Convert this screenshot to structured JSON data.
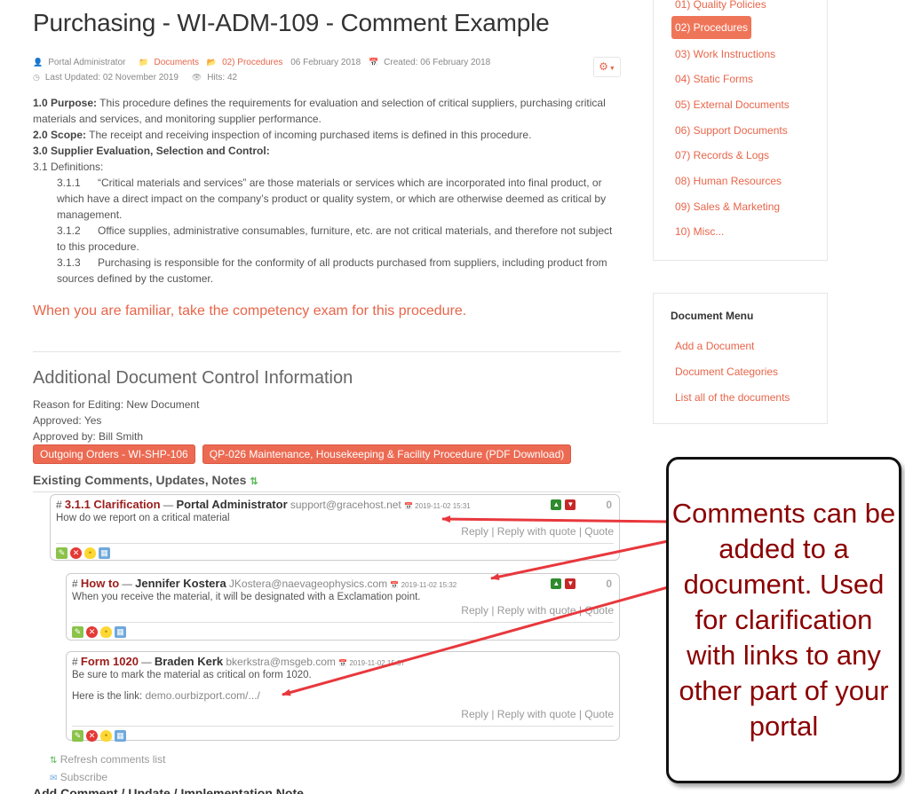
{
  "page": {
    "title": "Purchasing - WI-ADM-109 - Comment Example"
  },
  "meta": {
    "author": "Portal Administrator",
    "category_link": "Documents",
    "subcategory_link": "02) Procedures",
    "date": "06 February 2018",
    "created": "Created: 06 February 2018",
    "last_updated": "Last Updated: 02 November 2019",
    "hits": "Hits: 42"
  },
  "body": {
    "p1_label": "1.0  Purpose:",
    "p1_text": "  This procedure defines the requirements for evaluation and selection of critical suppliers, purchasing critical materials and services, and monitoring supplier performance.",
    "p2_label": "2.0  Scope:",
    "p2_text": " The receipt and receiving inspection of incoming purchased items is defined in this procedure.",
    "p3_label": "3.0  Supplier Evaluation, Selection and Control:",
    "p31": "3.1  Definitions:",
    "d1_num": "3.1.1",
    "d1_text": "“Critical materials and services” are those materials or services which are incorporated into final product, or which have a direct impact on the company’s product or quality system, or which are otherwise deemed as critical by management.",
    "d2_num": "3.1.2",
    "d2_text": "Office supplies, administrative consumables, furniture, etc. are not critical materials, and therefore not subject to this procedure.",
    "d3_num": "3.1.3",
    "d3_text": "Purchasing is responsible for the conformity of all products purchased from suppliers, including product from sources defined by the customer.",
    "exam_link": "When you are familiar, take the competency exam for this procedure."
  },
  "control": {
    "heading": "Additional Document Control Information",
    "reason": "Reason for Editing: New Document",
    "approved": "Approved: Yes",
    "approved_by": "Approved by: Bill Smith",
    "related": [
      "Outgoing Orders - WI-SHP-106",
      "QP-026 Maintenance, Housekeeping & Facility Procedure (PDF Download)"
    ]
  },
  "comments": {
    "heading": "Existing Comments, Updates, Notes",
    "items": [
      {
        "hash": "#",
        "title": "3.1.1 Clarification",
        "sep": " — ",
        "author": "Portal Administrator",
        "email": "support@gracehost.net",
        "date": "2019-11-02 15:31",
        "text": "How do we report on a critical material",
        "text2": "",
        "link": "",
        "score": "0"
      },
      {
        "hash": "#",
        "title": "How to",
        "sep": " — ",
        "author": "Jennifer Kostera",
        "email": "JKostera@naevageophysics.com",
        "date": "2019-11-02 15:32",
        "text": "When you receive the material, it will be designated with a Exclamation point.",
        "text2": "",
        "link": "",
        "score": "0"
      },
      {
        "hash": "#",
        "title": "Form 1020",
        "sep": " — ",
        "author": "Braden Kerk",
        "email": "bkerkstra@msgeb.com",
        "date": "2019-11-02 15:37",
        "text": "Be sure to mark the material as critical on form 1020.",
        "text2": "Here is the link: ",
        "link": "demo.ourbizport.com/.../",
        "score": ""
      }
    ],
    "actions": {
      "reply": "Reply",
      "reply_quote": "Reply with quote",
      "quote": "Quote",
      "sep": " | "
    },
    "refresh": "Refresh comments list",
    "subscribe": "Subscribe",
    "add_heading": "Add Comment / Update / Implementation Note"
  },
  "sidebar": {
    "categories": [
      "01) Quality Policies",
      "02) Procedures",
      "03) Work Instructions",
      "04) Static Forms",
      "05) External Documents",
      "06) Support Documents",
      "07) Records & Logs",
      "08) Human Resources",
      "09) Sales & Marketing",
      "10) Misc..."
    ],
    "active_index": 1,
    "menu_heading": "Document Menu",
    "menu_items": [
      "Add a Document",
      "Document Categories",
      "List all of the documents"
    ]
  },
  "callout": {
    "text": "Comments can be added to a document. Used for clarification with links to any other part of your portal"
  },
  "colors": {
    "accent": "#e8654a",
    "active_bg": "#ef7559",
    "comment_title": "#9b1c1c",
    "callout_text": "#8b0000",
    "arrow": "#e8383d"
  }
}
